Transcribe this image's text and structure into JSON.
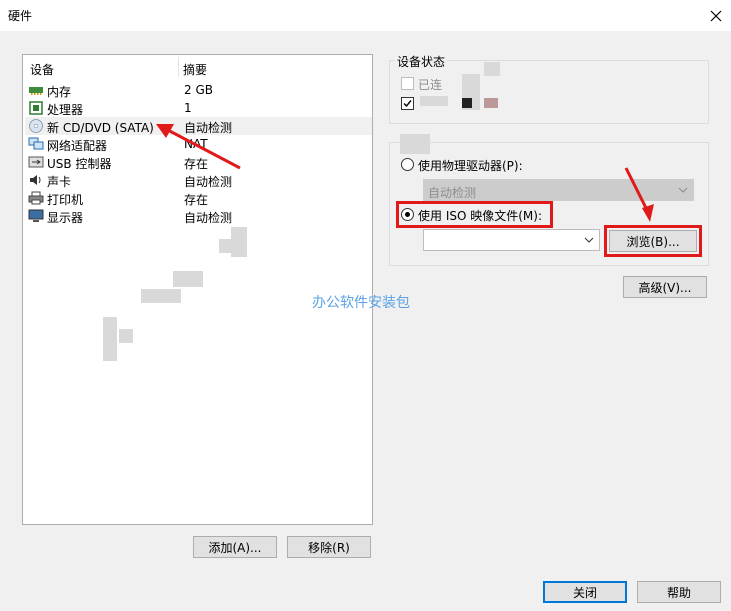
{
  "window": {
    "title": "硬件"
  },
  "device_list": {
    "col_device": "设备",
    "col_summary": "摘要",
    "items": [
      {
        "name": "内存",
        "summary": "2 GB",
        "icon": "memory-icon"
      },
      {
        "name": "处理器",
        "summary": "1",
        "icon": "cpu-icon"
      },
      {
        "name": "新 CD/DVD (SATA)",
        "summary": "自动检测",
        "icon": "cd-dvd-icon"
      },
      {
        "name": "网络适配器",
        "summary": "NAT",
        "icon": "network-adapter-icon"
      },
      {
        "name": "USB 控制器",
        "summary": "存在",
        "icon": "usb-icon"
      },
      {
        "name": "声卡",
        "summary": "自动检测",
        "icon": "sound-card-icon"
      },
      {
        "name": "打印机",
        "summary": "存在",
        "icon": "printer-icon"
      },
      {
        "name": "显示器",
        "summary": "自动检测",
        "icon": "display-icon"
      }
    ]
  },
  "left_buttons": {
    "add": "添加(A)...",
    "remove": "移除(R)"
  },
  "device_status": {
    "title": "设备状态",
    "connected": "已连",
    "connected_checked": false,
    "connect_on_power_checked": true
  },
  "connection": {
    "physical_label": "使用物理驱动器(P):",
    "physical_value": "自动检测",
    "iso_label": "使用 ISO 映像文件(M):",
    "iso_value": "",
    "browse": "浏览(B)..."
  },
  "advanced": "高级(V)...",
  "footer": {
    "close": "关闭",
    "help": "帮助"
  },
  "watermark": "办公软件安装包",
  "colors": {
    "annotation_red": "#e01a1a",
    "accent_blue": "#0078d7",
    "watermark_blue": "#5aa3e6"
  }
}
